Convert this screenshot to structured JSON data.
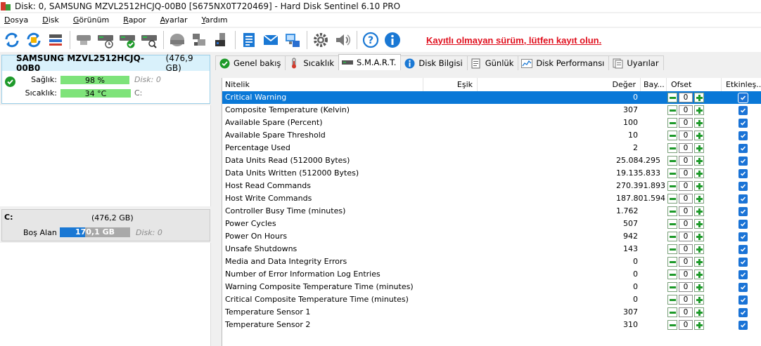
{
  "window": {
    "title": "Disk: 0, SAMSUNG MZVL2512HCJQ-00B0 [S675NX0T720469]  -  Hard Disk Sentinel 6.10 PRO"
  },
  "menu": {
    "items": [
      {
        "underline": "D",
        "rest": "osya"
      },
      {
        "underline": "D",
        "rest": "isk"
      },
      {
        "underline": "G",
        "rest": "örünüm"
      },
      {
        "underline": "R",
        "rest": "apor"
      },
      {
        "underline": "A",
        "rest": "yarlar"
      },
      {
        "underline": "Y",
        "rest": "ardım"
      }
    ]
  },
  "toolbar": {
    "unregistered_link": "Kayıtlı olmayan sürüm, lütfen kayıt olun.",
    "accent_blue": "#1a78d4",
    "icons": [
      "refresh-icon",
      "refresh-all-icon",
      "disk-list-icon",
      "disk-info-icon",
      "disk-schedule-icon",
      "disk-check-icon",
      "disk-search-icon",
      "hdd-icon",
      "network-icon",
      "usb-icon",
      "notes-icon",
      "email-icon",
      "network-alert-icon",
      "settings-icon",
      "sound-icon",
      "help-icon",
      "info-icon"
    ]
  },
  "disk": {
    "model": "SAMSUNG MZVL2512HCJQ-00B0",
    "size": "(476,9 GB)",
    "health_label": "Sağlık:",
    "health_value": "98 %",
    "health_percent": 98,
    "health_right": "Disk: 0",
    "temp_label": "Sıcaklık:",
    "temp_value": "34 °C",
    "temp_right": "C:",
    "bar_color": "#7ee37a"
  },
  "volume": {
    "letter": "C:",
    "size": "(476,2 GB)",
    "free_label": "Boş Alan",
    "free_value": "170,1 GB",
    "free_fraction": 0.357,
    "disk_ref": "Disk: 0"
  },
  "tabs": [
    {
      "label": "Genel bakış",
      "icon": "check-circle-icon"
    },
    {
      "label": "Sıcaklık",
      "icon": "thermometer-icon"
    },
    {
      "label": "S.M.A.R.T.",
      "icon": "drive-icon",
      "active": true
    },
    {
      "label": "Disk Bilgisi",
      "icon": "info-icon"
    },
    {
      "label": "Günlük",
      "icon": "log-icon"
    },
    {
      "label": "Disk Performansı",
      "icon": "performance-icon"
    },
    {
      "label": "Uyarılar",
      "icon": "alerts-icon"
    }
  ],
  "table": {
    "headers": {
      "attribute": "Nitelik",
      "threshold": "Eşik",
      "value": "Değer",
      "flags": "Bay...",
      "offset": "Ofset",
      "enabled": "Etkinleş..."
    },
    "rows": [
      {
        "name": "Critical Warning",
        "value": "0",
        "offset": "0",
        "selected": true
      },
      {
        "name": "Composite Temperature (Kelvin)",
        "value": "307",
        "offset": "0"
      },
      {
        "name": "Available Spare (Percent)",
        "value": "100",
        "offset": "0"
      },
      {
        "name": "Available Spare Threshold",
        "value": "10",
        "offset": "0"
      },
      {
        "name": "Percentage Used",
        "value": "2",
        "offset": "0"
      },
      {
        "name": "Data Units Read (512000 Bytes)",
        "value": "25.084.295",
        "offset": "0"
      },
      {
        "name": "Data Units Written (512000 Bytes)",
        "value": "19.135.833",
        "offset": "0"
      },
      {
        "name": "Host Read Commands",
        "value": "270.391.893",
        "offset": "0"
      },
      {
        "name": "Host Write Commands",
        "value": "187.801.594",
        "offset": "0"
      },
      {
        "name": "Controller Busy Time (minutes)",
        "value": "1.762",
        "offset": "0"
      },
      {
        "name": "Power Cycles",
        "value": "507",
        "offset": "0"
      },
      {
        "name": "Power On Hours",
        "value": "942",
        "offset": "0"
      },
      {
        "name": "Unsafe Shutdowns",
        "value": "143",
        "offset": "0"
      },
      {
        "name": "Media and Data Integrity Errors",
        "value": "0",
        "offset": "0"
      },
      {
        "name": "Number of Error Information Log Entries",
        "value": "0",
        "offset": "0"
      },
      {
        "name": "Warning Composite Temperature Time (minutes)",
        "value": "0",
        "offset": "0"
      },
      {
        "name": "Critical Composite Temperature Time (minutes)",
        "value": "0",
        "offset": "0"
      },
      {
        "name": "Temperature Sensor 1",
        "value": "307",
        "offset": "0"
      },
      {
        "name": "Temperature Sensor 2",
        "value": "310",
        "offset": "0"
      }
    ],
    "selection_color": "#0a78d7"
  }
}
